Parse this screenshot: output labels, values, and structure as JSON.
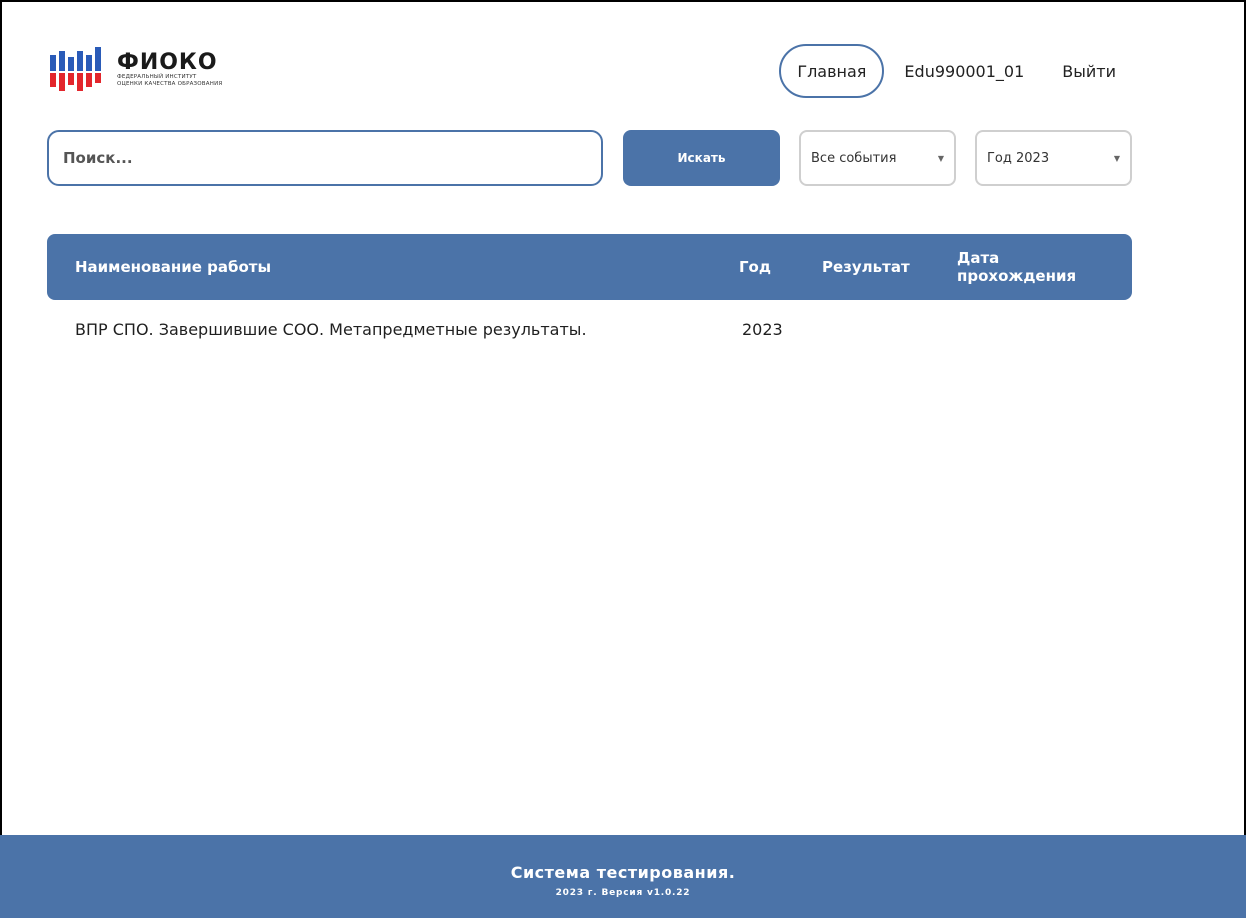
{
  "brand": {
    "title": "ФИОКО",
    "subtitle_line1": "ФЕДЕРАЛЬНЫЙ ИНСТИТУТ",
    "subtitle_line2": "ОЦЕНКИ КАЧЕСТВА ОБРАЗОВАНИЯ",
    "logo_icon": "fioko-logo-icon",
    "colors": {
      "blue": "#2a5bb8",
      "red": "#e3262c"
    }
  },
  "nav": {
    "home": "Главная",
    "user": "Edu990001_01",
    "logout": "Выйти"
  },
  "search": {
    "placeholder": "Поиск...",
    "button": "Искать"
  },
  "filters": {
    "events": {
      "selected": "Все события",
      "icon": "chevron-down-icon"
    },
    "year": {
      "selected": "Год 2023",
      "icon": "chevron-down-icon"
    }
  },
  "table": {
    "columns": [
      "Наименование работы",
      "Год",
      "Результат",
      "Дата прохождения"
    ],
    "date_col_line1": "Дата",
    "date_col_line2": "прохождения",
    "rows": [
      {
        "name": "ВПР СПО. Завершившие СОО. Метапредметные результаты.",
        "year": "2023",
        "result": "",
        "date": ""
      }
    ]
  },
  "footer": {
    "title": "Система тестирования.",
    "version": "2023 г. Версия v1.0.22"
  },
  "theme": {
    "accent": "#4b73a8"
  }
}
